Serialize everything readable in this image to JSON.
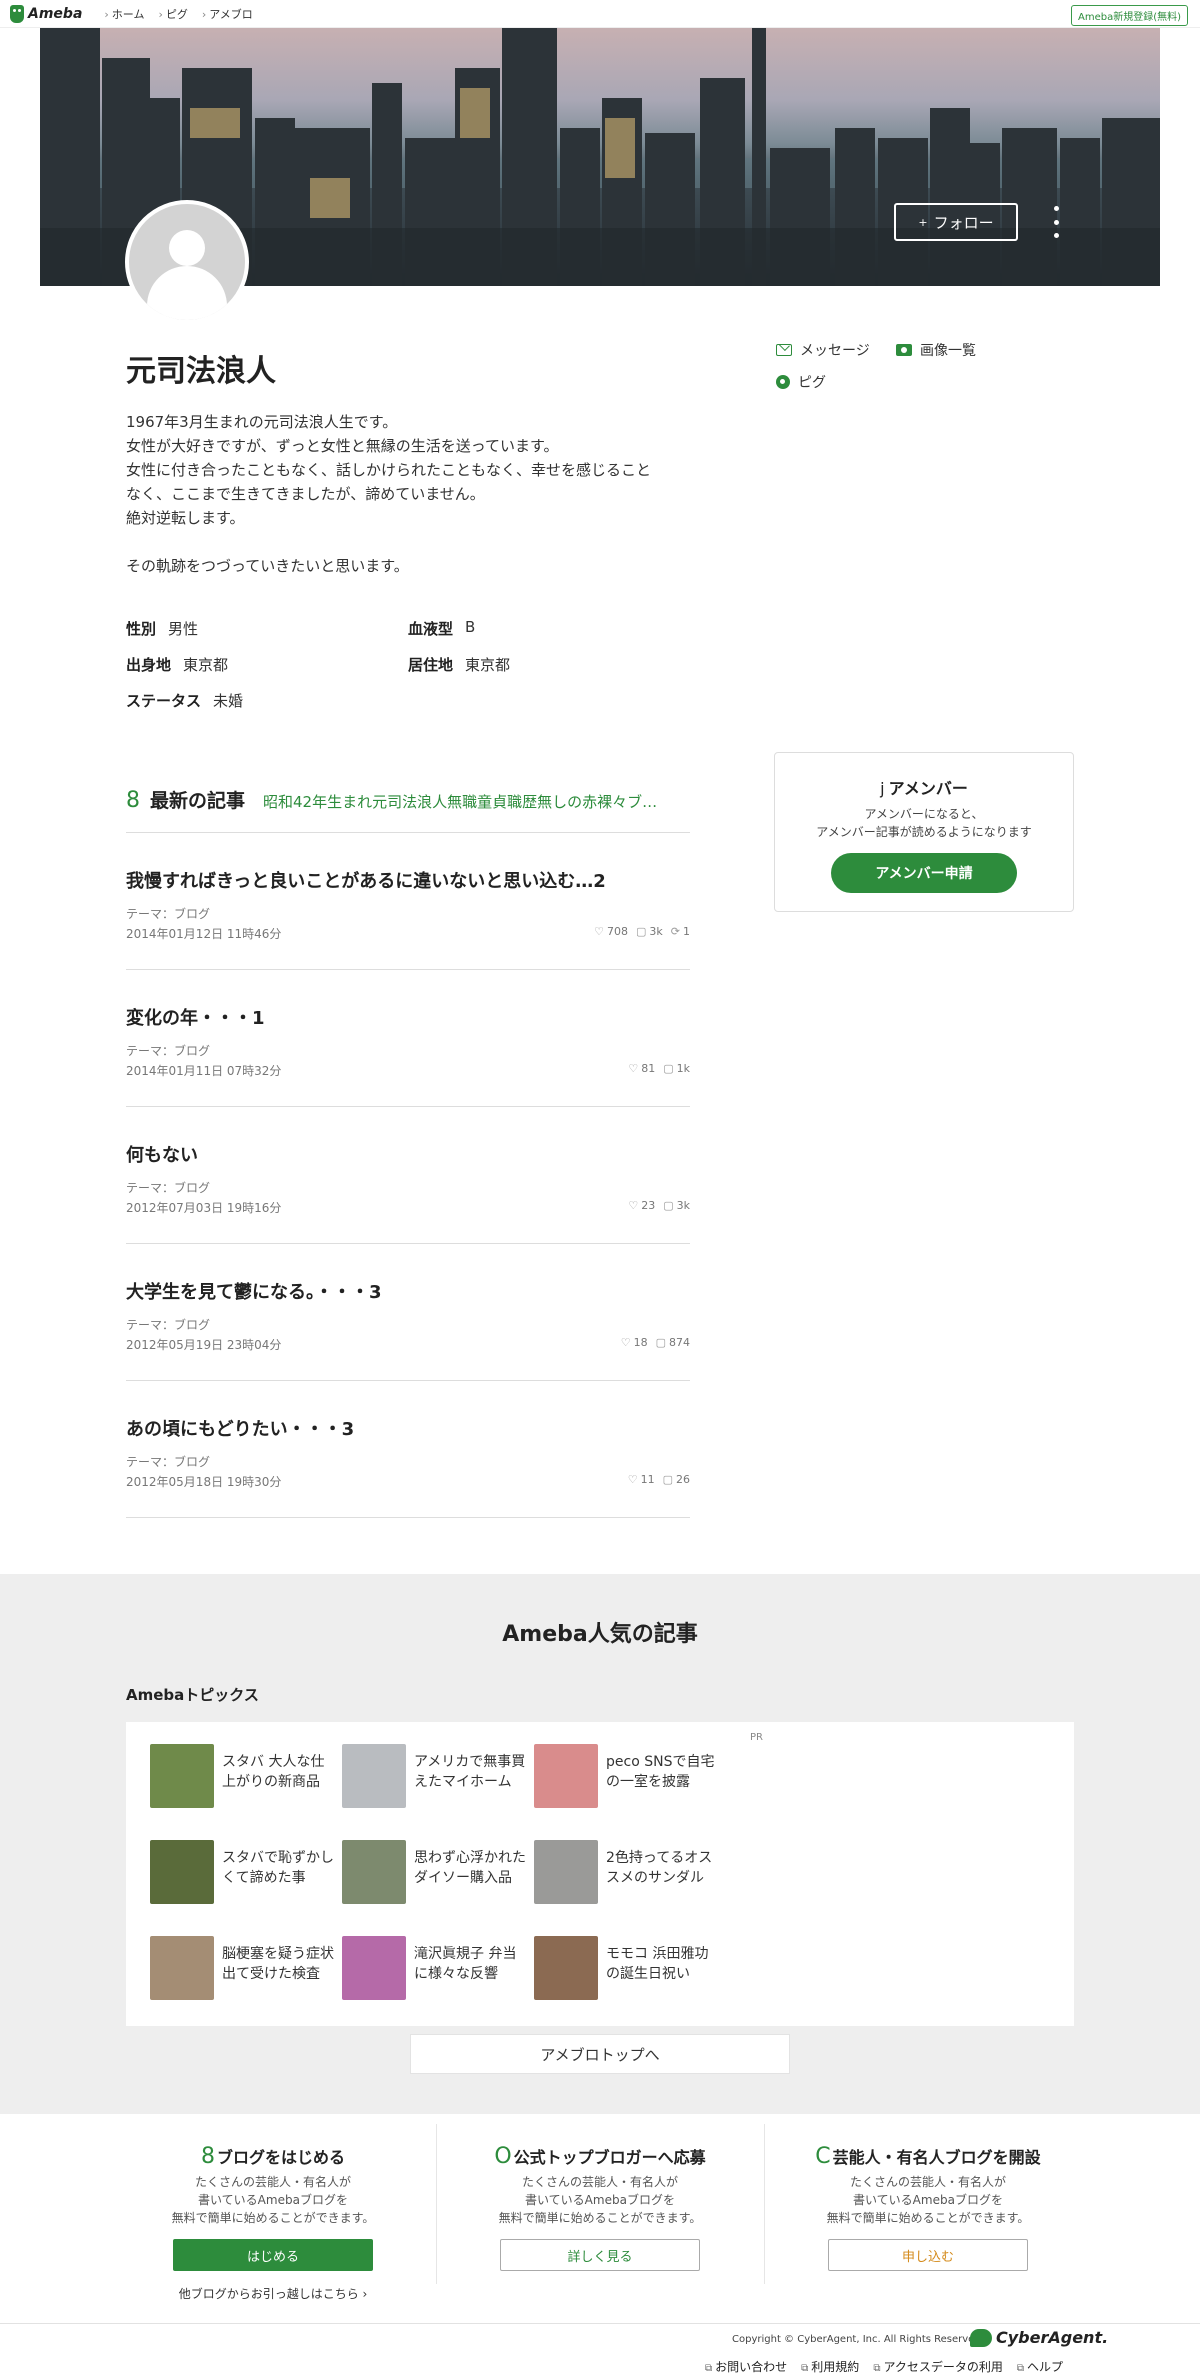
{
  "topbar": {
    "logo": "Ameba",
    "nav": [
      "ホーム",
      "ピグ",
      "アメブロ"
    ],
    "signup": "Ameba新規登録(無料)"
  },
  "cover": {
    "follow_label": "フォロー",
    "follow_icon": "plus-icon"
  },
  "profile": {
    "name": "元司法浪人",
    "bio": [
      "1967年3月生まれの元司法浪人生です。",
      "女性が大好きですが、ずっと女性と無縁の生活を送っています。",
      "女性に付き合ったこともなく、話しかけられたこともなく、幸せを感じること",
      "なく、ここまで生きてきましたが、諦めていません。",
      "絶対逆転します。",
      "",
      "その軌跡をつづっていきたいと思います。"
    ],
    "attributes": [
      {
        "key": "性別",
        "value": "男性"
      },
      {
        "key": "血液型",
        "value": "B"
      },
      {
        "key": "出身地",
        "value": "東京都"
      },
      {
        "key": "居住地",
        "value": "東京都"
      },
      {
        "key": "ステータス",
        "value": "未婚"
      }
    ]
  },
  "side_links": {
    "message": "メッセージ",
    "images": "画像一覧",
    "pigg": "ピグ"
  },
  "amember": {
    "icon": "j",
    "title": "アメンバー",
    "desc1": "アメンバーになると、",
    "desc2": "アメンバー記事が読めるようになります",
    "button": "アメンバー申請"
  },
  "latest": {
    "icon": "8",
    "title": "最新の記事",
    "blog_link": "昭和42年生まれ元司法浪人無職童貞職歴無しの赤裸々ブ…"
  },
  "articles": [
    {
      "title": "我慢すればきっと良いことがあるに違いないと思い込む…2",
      "theme": "テーマ：ブログ",
      "date": "2014年01月12日 11時46分",
      "likes": "708",
      "comments": "3k",
      "reblogs": "1"
    },
    {
      "title": "変化の年・・・1",
      "theme": "テーマ：ブログ",
      "date": "2014年01月11日 07時32分",
      "likes": "81",
      "comments": "1k",
      "reblogs": ""
    },
    {
      "title": "何もない",
      "theme": "テーマ：ブログ",
      "date": "2012年07月03日 19時16分",
      "likes": "23",
      "comments": "3k",
      "reblogs": ""
    },
    {
      "title": "大学生を見て鬱になる。・・・3",
      "theme": "テーマ：ブログ",
      "date": "2012年05月19日 23時04分",
      "likes": "18",
      "comments": "874",
      "reblogs": ""
    },
    {
      "title": "あの頃にもどりたい・・・3",
      "theme": "テーマ：ブログ",
      "date": "2012年05月18日 19時30分",
      "likes": "11",
      "comments": "26",
      "reblogs": ""
    }
  ],
  "popular": {
    "title": "Ameba人気の記事",
    "topics_label": "Amebaトピックス",
    "pr": "PR",
    "topics": [
      {
        "title": "スタバ 大人な仕上がりの新商品",
        "color": "#6f8a4a"
      },
      {
        "title": "アメリカで無事買えたマイホーム",
        "color": "#b9bcc0"
      },
      {
        "title": "peco SNSで自宅の一室を披露",
        "color": "#d98c8c"
      },
      {
        "title": "スタバで恥ずかしくて諦めた事",
        "color": "#5a6b3a"
      },
      {
        "title": "思わず心浮かれたダイソー購入品",
        "color": "#7d8a6e"
      },
      {
        "title": "2色持ってるオススメのサンダル",
        "color": "#9a9a98"
      },
      {
        "title": "脳梗塞を疑う症状出て受けた検査",
        "color": "#a48d74"
      },
      {
        "title": "滝沢眞規子 弁当に様々な反響",
        "color": "#b56aa8"
      },
      {
        "title": "モモコ 浜田雅功の誕生日祝い",
        "color": "#8b6a52"
      }
    ],
    "to_top": "アメブロトップへ"
  },
  "cta": [
    {
      "icon": "8",
      "title": "ブログをはじめる",
      "desc": [
        "たくさんの芸能人・有名人が",
        "書いているAmebaブログを",
        "無料で簡単に始めることができます。"
      ],
      "button": "はじめる",
      "sub": "他ブログからお引っ越しはこちら ›"
    },
    {
      "icon": "O",
      "title": "公式トップブロガーへ応募",
      "desc": [
        "たくさんの芸能人・有名人が",
        "書いているAmebaブログを",
        "無料で簡単に始めることができます。"
      ],
      "button": "詳しく見る"
    },
    {
      "icon": "C",
      "title": "芸能人・有名人ブログを開設",
      "desc": [
        "たくさんの芸能人・有名人が",
        "書いているAmebaブログを",
        "無料で簡単に始めることができます。"
      ],
      "button": "申し込む"
    }
  ],
  "footer": {
    "copyright": "Copyright © CyberAgent, Inc. All Rights Reserved.",
    "logo": "CyberAgent.",
    "links": [
      "お問い合わせ",
      "利用規約",
      "アクセスデータの利用",
      "ヘルプ"
    ]
  },
  "colors": {
    "brand_green": "#2d8c3c",
    "section_gray": "#eeeeee"
  }
}
